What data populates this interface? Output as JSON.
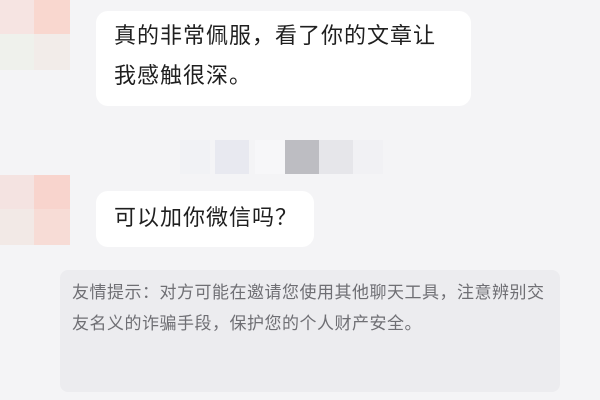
{
  "messages": [
    {
      "lines": [
        "真的非常佩服，看了你的文章让",
        "我感触很深。"
      ]
    },
    {
      "lines": [
        "可以加你微信吗？"
      ]
    }
  ],
  "system_tip": {
    "text": "友情提示：对方可能在邀请您使用其他聊天工具，注意辨别交友名义的诈骗手段，保护您的个人财产安全。"
  },
  "colors": {
    "background": "#f4f4f6",
    "bubble": "#ffffff",
    "bubble_text": "#1f1f1f",
    "tip_background": "#ececef",
    "tip_text": "#6f6f74"
  }
}
